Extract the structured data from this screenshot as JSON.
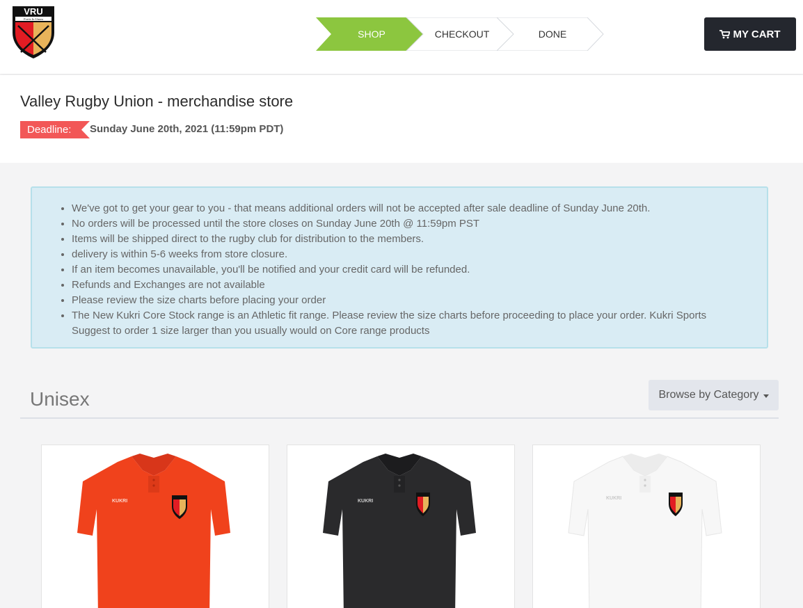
{
  "header": {
    "logo_text": "VRU",
    "logo_motto": "Fortis In Unum",
    "steps": [
      "SHOP",
      "CHECKOUT",
      "DONE"
    ],
    "active_step": "SHOP",
    "cart_label": "MY CART",
    "cart_icon": "shopping-cart-icon"
  },
  "store": {
    "title": "Valley Rugby Union - merchandise store",
    "deadline_label": "Deadline:",
    "deadline_value": "Sunday June 20th, 2021 (11:59pm PDT)"
  },
  "notice": {
    "items": [
      "We've got to get your gear to you - that means additional orders will not be accepted after sale deadline of Sunday June 20th.",
      "No orders will be processed until the store closes on Sunday June 20th @ 11:59pm PST",
      "Items will be shipped direct to the rugby club for distribution to the members.",
      "delivery is within 5-6 weeks from store closure.",
      "If an item becomes unavailable, you'll be notified and your credit card will be refunded.",
      "Refunds and Exchanges are not available",
      "Please review the size charts before placing your order",
      "The New Kukri Core Stock range is an Athletic fit range. Please review the size charts before proceeding to place your order. Kukri Sports Suggest to order 1 size larger than you usually would on Core range products"
    ]
  },
  "section": {
    "title": "Unisex",
    "browse_label": "Browse by Category"
  },
  "products": [
    {
      "name": "red-polo",
      "color": "#f0421c",
      "brand": "KUKRI"
    },
    {
      "name": "black-polo",
      "color": "#2a2a2c",
      "brand": "KUKRI"
    },
    {
      "name": "white-polo",
      "color": "#f7f7f7",
      "brand": "KUKRI"
    }
  ],
  "colors": {
    "accent_green": "#8cc63f",
    "deadline_red": "#f25757",
    "cart_dark": "#24272e",
    "notice_bg": "#d9ecf4"
  }
}
